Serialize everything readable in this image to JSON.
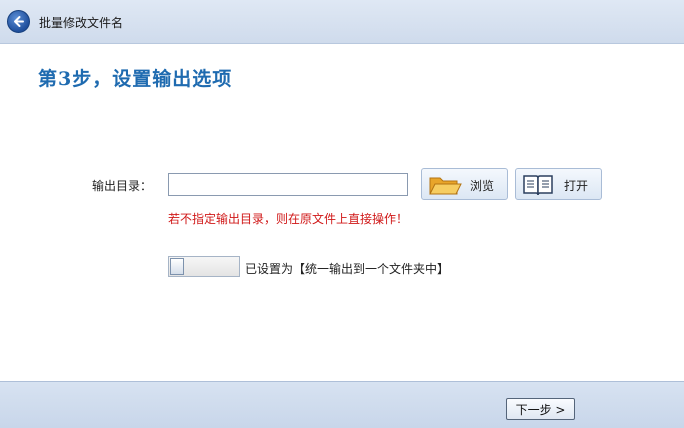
{
  "header": {
    "back_icon": "back-arrow-icon",
    "title": "批量修改文件名"
  },
  "step": {
    "title": "第3步，设置输出选项"
  },
  "output": {
    "label": "输出目录：",
    "value": "",
    "placeholder": "",
    "browse_label": "浏览",
    "browse_icon": "folder-icon",
    "open_label": "打开",
    "open_icon": "book-icon",
    "warning": "若不指定输出目录，则在原文件上直接操作！"
  },
  "toggle": {
    "state": "off",
    "label": "已设置为【统一输出到一个文件夹中】"
  },
  "footer": {
    "next_label": "下一步 >"
  },
  "colors": {
    "accent": "#1f6bb0",
    "warning": "#d01818",
    "header_bg": "#dfe8f4",
    "footer_bg": "#d7e2f1"
  }
}
